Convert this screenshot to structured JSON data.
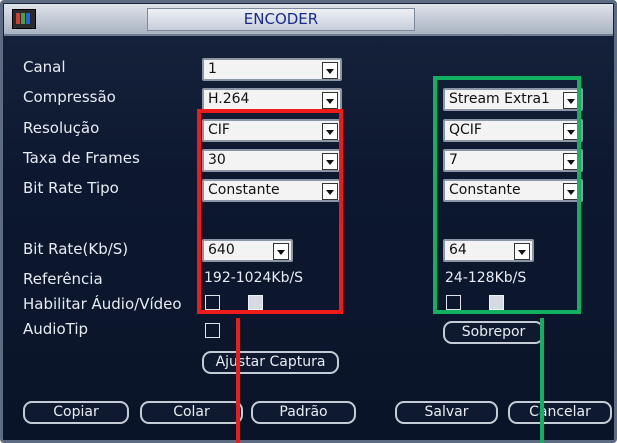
{
  "window": {
    "title": "ENCODER"
  },
  "labels": {
    "canal": "Canal",
    "compressao": "Compressão",
    "resolucao": "Resolução",
    "taxa_frames": "Taxa de Frames",
    "bit_rate_tipo": "Bit Rate Tipo",
    "bit_rate": "Bit Rate(Kb/S)",
    "referencia": "Referência",
    "habilitar": "Habilitar Áudio/Vídeo",
    "audiotip": "AudioTip"
  },
  "main_stream": {
    "canal": "1",
    "compressao": "H.264",
    "resolucao": "CIF",
    "taxa_frames": "30",
    "bit_rate_tipo": "Constante",
    "bit_rate": "640",
    "referencia": "192-1024Kb/S",
    "audio_enabled": false,
    "video_enabled": true
  },
  "extra_stream": {
    "stream": "Stream Extra1",
    "resolucao": "QCIF",
    "taxa_frames": "7",
    "bit_rate_tipo": "Constante",
    "bit_rate": "64",
    "referencia": "24-128Kb/S",
    "audio_enabled": false,
    "video_enabled": true
  },
  "audiotip_checked": false,
  "buttons": {
    "ajustar_captura": "Ajustar Captura",
    "sobrepor": "Sobrepor",
    "copiar": "Copiar",
    "colar": "Colar",
    "padrao": "Padrão",
    "salvar": "Salvar",
    "cancelar": "Cancelar"
  },
  "colors": {
    "highlight_main": "#ee1b1b",
    "highlight_extra": "#11b15f",
    "background": "#0d1830",
    "title_text": "#1a2a8a"
  }
}
